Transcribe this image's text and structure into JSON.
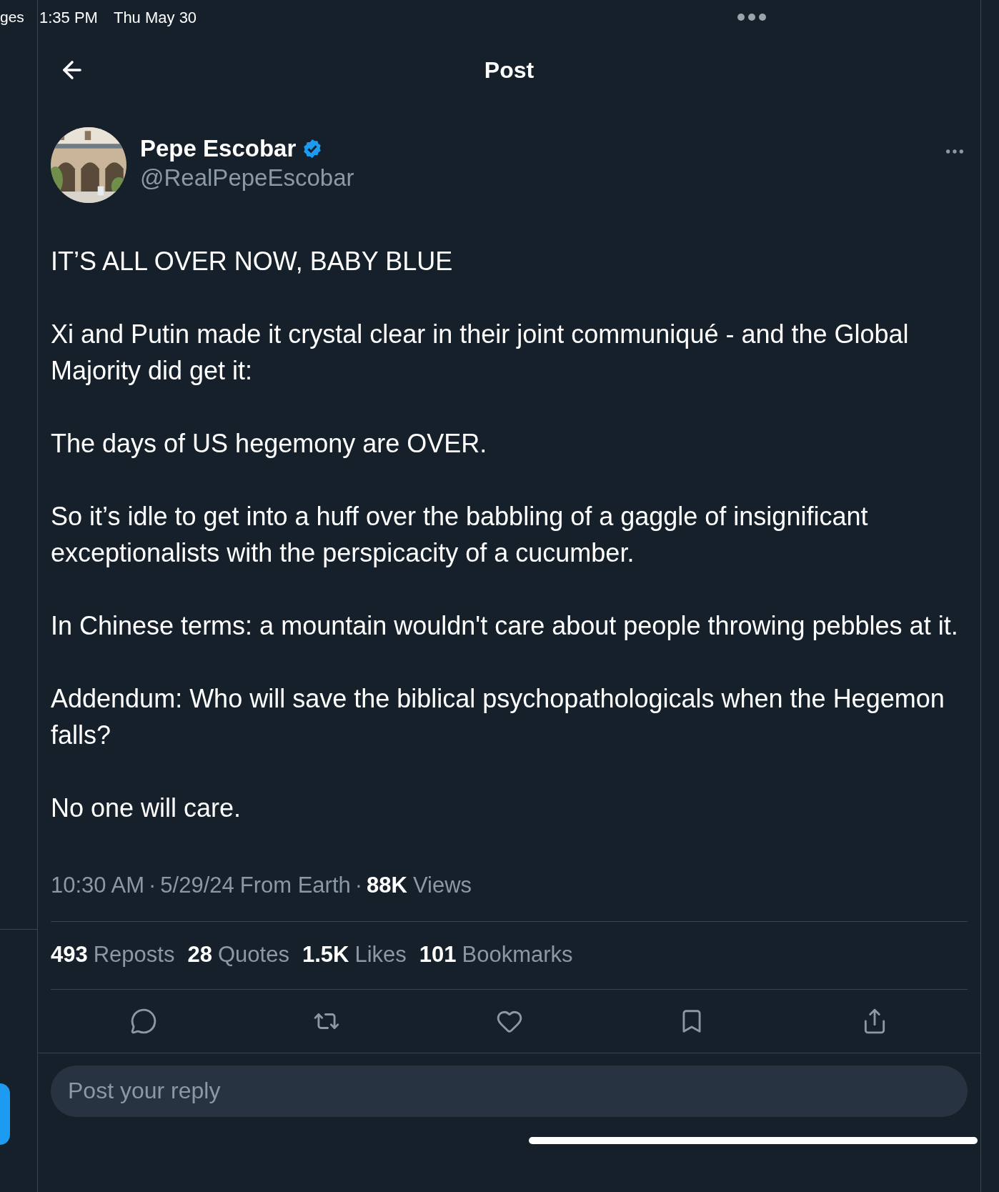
{
  "status_bar": {
    "left_app_cut": "ges",
    "time": "1:35 PM",
    "date": "Thu May 30"
  },
  "header": {
    "title": "Post"
  },
  "author": {
    "name": "Pepe Escobar",
    "verified": true,
    "handle": "@RealPepeEscobar"
  },
  "post": {
    "paragraphs": [
      "IT’S ALL OVER NOW, BABY BLUE",
      "Xi and Putin made it crystal clear in their joint communiqué - and the Global Majority did get it:",
      "The days of US hegemony are OVER.",
      "So it’s idle to get into a huff over the babbling of a gaggle of insignificant exceptionalists with the perspicacity of a cucumber.",
      "In Chinese terms: a mountain wouldn't care about people throwing pebbles at it.",
      "Addendum: Who will save the biblical psychopathologicals when the Hegemon falls?",
      "No one will care."
    ]
  },
  "meta": {
    "time": "10:30 AM",
    "separator_1": "·",
    "date": "5/29/24",
    "source": "From Earth",
    "separator_2": "·",
    "views_count": "88K",
    "views_label": "Views"
  },
  "stats": [
    {
      "count": "493",
      "label": "Reposts"
    },
    {
      "count": "28",
      "label": "Quotes"
    },
    {
      "count": "1.5K",
      "label": "Likes"
    },
    {
      "count": "101",
      "label": "Bookmarks"
    }
  ],
  "reply": {
    "placeholder": "Post your reply"
  }
}
